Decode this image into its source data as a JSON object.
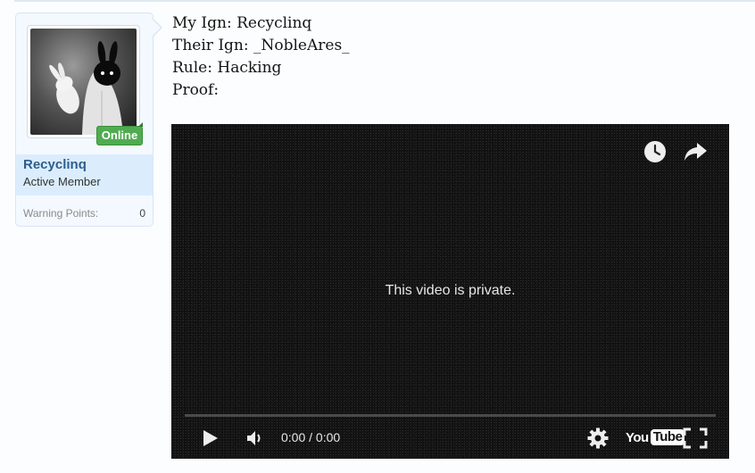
{
  "user": {
    "username": "Recyclinq",
    "title": "Active Member",
    "status": "Online",
    "warning_label": "Warning Points:",
    "warning_value": "0"
  },
  "post": {
    "lines": [
      "My Ign: Recyclinq",
      "Their Ign: _NobleAres_",
      "Rule: Hacking",
      "Proof:"
    ]
  },
  "video": {
    "message": "This video is private.",
    "time": "0:00 / 0:00",
    "logo_you": "You",
    "logo_tube": "Tube",
    "progress": 0
  },
  "icons": {
    "watch_later": "clock-icon",
    "share": "share-icon",
    "play": "play-icon",
    "volume": "volume-icon",
    "settings": "gear-icon",
    "fullscreen": "fullscreen-icon"
  }
}
